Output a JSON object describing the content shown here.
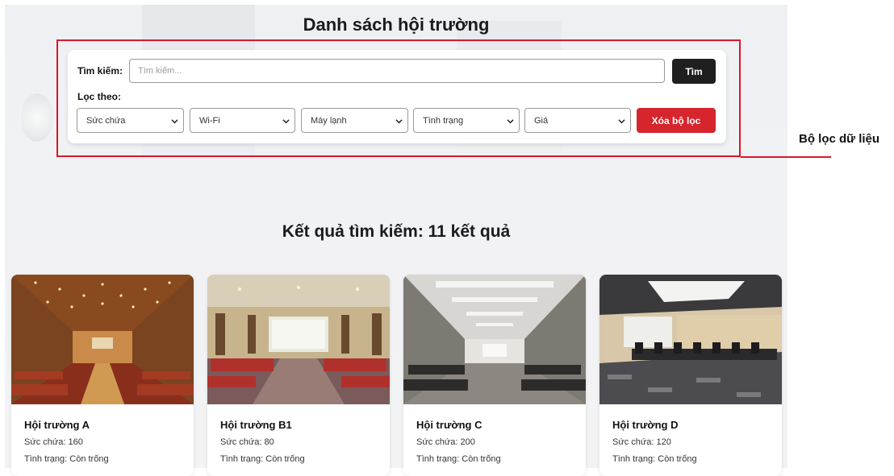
{
  "page_title": "Danh sách hội trường",
  "filter": {
    "search_label": "Tìm kiếm:",
    "search_placeholder": "Tìm kiếm...",
    "search_value": "",
    "search_button": "Tìm",
    "filter_label": "Lọc theo:",
    "selects": [
      {
        "name": "capacity-select",
        "value": "Sức chứa"
      },
      {
        "name": "wifi-select",
        "value": "Wi-Fi"
      },
      {
        "name": "aircon-select",
        "value": "Máy lạnh"
      },
      {
        "name": "status-select",
        "value": "Tình trạng"
      },
      {
        "name": "price-select",
        "value": "Giá"
      }
    ],
    "clear_button": "Xóa bộ lọc"
  },
  "annotation": {
    "label": "Bộ lọc dữ liệu",
    "color": "#d8182a"
  },
  "results": {
    "title": "Kết quả tìm kiếm: 11 kết quả",
    "cards": [
      {
        "name": "Hội trường A",
        "capacity": "Sức chứa: 160",
        "status": "Tình trạng: Còn trống"
      },
      {
        "name": "Hội trường B1",
        "capacity": "Sức chứa: 80",
        "status": "Tình trạng: Còn trống"
      },
      {
        "name": "Hội trường C",
        "capacity": "Sức chứa: 200",
        "status": "Tình trạng: Còn trống"
      },
      {
        "name": "Hội trường D",
        "capacity": "Sức chứa: 120",
        "status": "Tình trạng: Còn trống"
      }
    ]
  },
  "colors": {
    "accent_red": "#d6252c",
    "dark_button": "#1f1f1f"
  },
  "icons": [
    "chevron-down-icon"
  ]
}
